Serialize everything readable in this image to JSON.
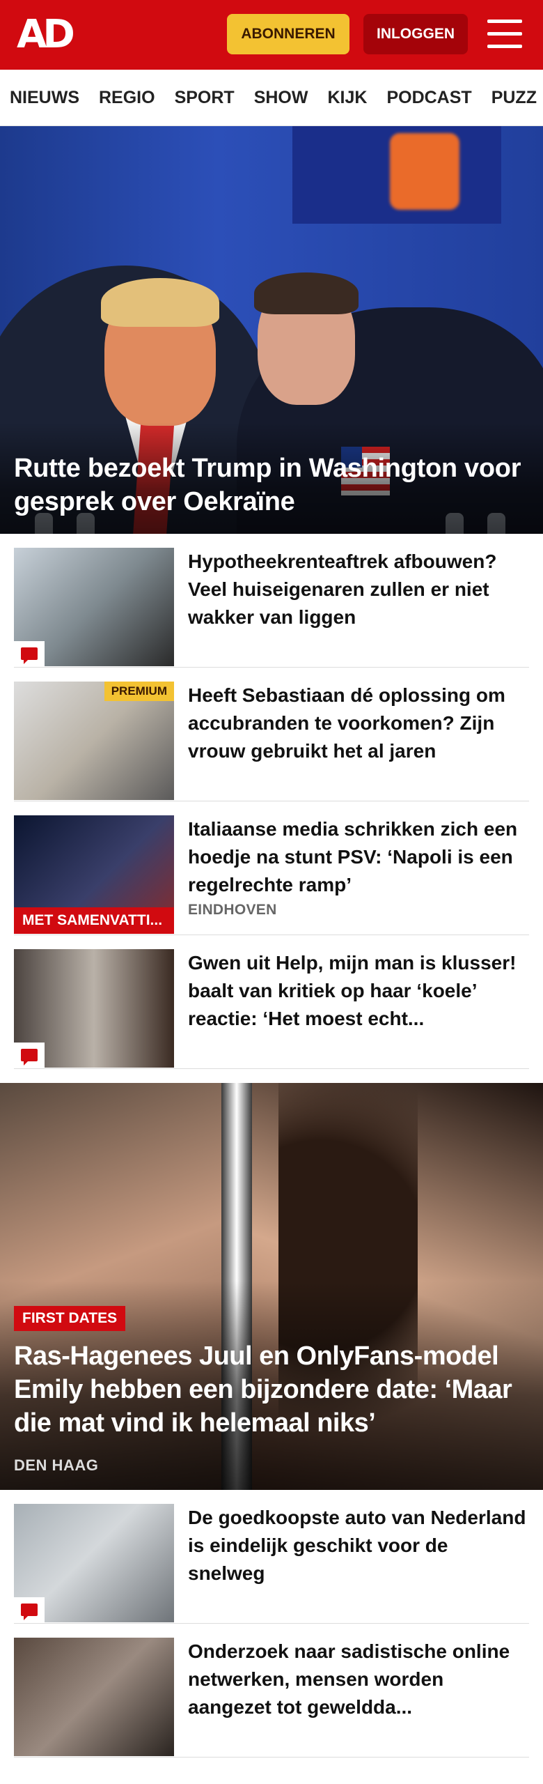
{
  "header": {
    "logo": "AD",
    "subscribe_label": "ABONNEREN",
    "login_label": "INLOGGEN",
    "menu_icon": "hamburger-menu-icon",
    "brand_color": "#d10a10",
    "subscribe_color": "#f3c232"
  },
  "nav": {
    "items": [
      "NIEUWS",
      "REGIO",
      "SPORT",
      "SHOW",
      "KIJK",
      "PODCAST",
      "PUZZ"
    ]
  },
  "hero": {
    "title": "Rutte bezoekt Trump in Washington voor gesprek over Oekraïne"
  },
  "articles": [
    {
      "title": "Hypotheekrenteaftrek afbouwen? Veel huiseigenaren zullen er niet wakker van liggen",
      "comments_icon": "comment-icon"
    },
    {
      "title": "Heeft Sebastiaan dé oplossing om accubranden te voorkomen? Zijn vrouw gebruikt het al jaren",
      "premium_label": "PREMIUM"
    },
    {
      "title": "Italiaanse media schrikken zich een hoedje na stunt PSV: ‘Napoli is een regelrechte ramp’",
      "location": "EINDHOVEN",
      "thumb_label": "MET SAMENVATTI..."
    },
    {
      "title": "Gwen uit Help, mijn man is klusser! baalt van kritiek op haar ‘koele’ reactie: ‘Het moest echt...",
      "comments_icon": "comment-icon"
    }
  ],
  "feature": {
    "tag": "FIRST DATES",
    "title": "Ras-Hagenees Juul en OnlyFans-model Emily hebben een bijzondere date: ‘Maar die mat vind ik helemaal niks’",
    "location": "DEN HAAG"
  },
  "articles2": [
    {
      "title": "De goedkoopste auto van Nederland is eindelijk geschikt voor de snelweg",
      "comments_icon": "comment-icon"
    },
    {
      "title": "Onderzoek naar sadistische online netwerken, mensen worden aangezet tot gewelddа..."
    }
  ]
}
